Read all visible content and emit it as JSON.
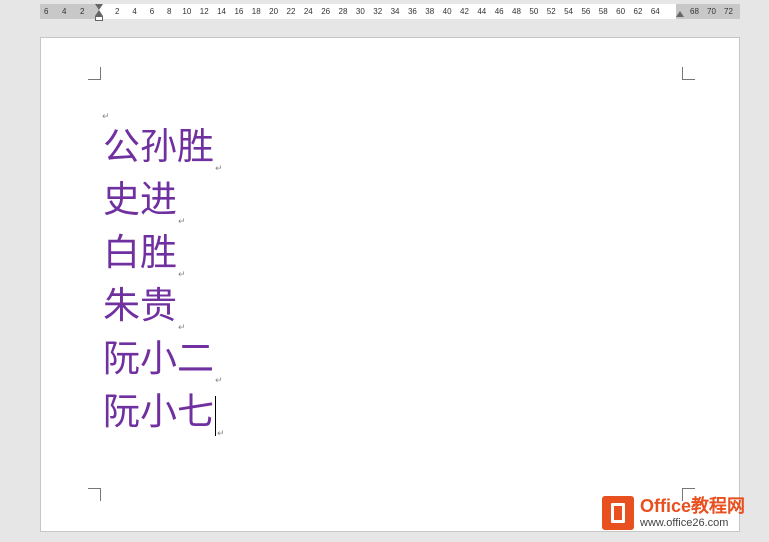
{
  "ruler": {
    "left_numbers": [
      "6",
      "4",
      "2"
    ],
    "main_numbers": [
      "2",
      "4",
      "6",
      "8",
      "10",
      "12",
      "14",
      "16",
      "18",
      "20",
      "22",
      "24",
      "26",
      "28",
      "30",
      "32",
      "34",
      "36",
      "38",
      "40",
      "42",
      "44",
      "46",
      "48",
      "50",
      "52",
      "54",
      "56",
      "58",
      "60",
      "62",
      "64"
    ],
    "right_numbers": [
      "68",
      "70",
      "72"
    ]
  },
  "document": {
    "paragraph_mark": "↵",
    "lines": [
      "公孙胜",
      "史进",
      "白胜",
      "朱贵",
      "阮小二",
      "阮小七"
    ],
    "text_color": "#7030a0"
  },
  "watermark": {
    "title": "Office教程网",
    "url": "www.office26.com",
    "brand_color": "#e8501f"
  }
}
